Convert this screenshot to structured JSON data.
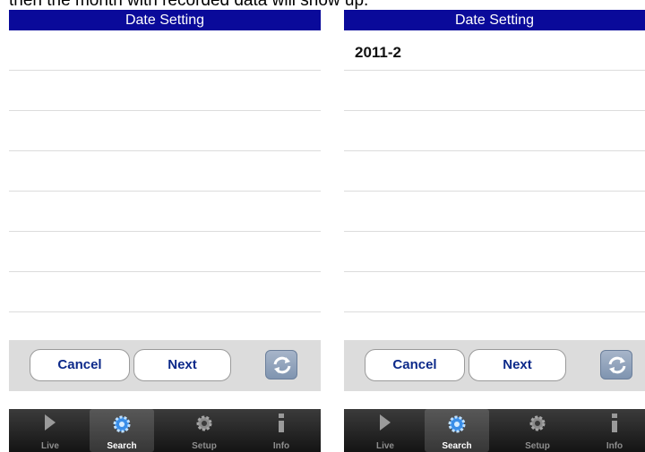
{
  "caption": "then the month with recorded data will show up.",
  "screens": [
    {
      "header_title": "Date Setting",
      "rows": [
        "",
        "",
        "",
        "",
        "",
        "",
        ""
      ],
      "cancel_label": "Cancel",
      "next_label": "Next",
      "tabs": [
        {
          "label": "Live",
          "icon": "play-icon"
        },
        {
          "label": "Search",
          "icon": "gear-icon",
          "active": true
        },
        {
          "label": "Setup",
          "icon": "gear-icon"
        },
        {
          "label": "Info",
          "icon": "info-icon"
        }
      ]
    },
    {
      "header_title": "Date Setting",
      "rows": [
        "2011-2",
        "",
        "",
        "",
        "",
        "",
        ""
      ],
      "cancel_label": "Cancel",
      "next_label": "Next",
      "tabs": [
        {
          "label": "Live",
          "icon": "play-icon"
        },
        {
          "label": "Search",
          "icon": "gear-icon",
          "active": true
        },
        {
          "label": "Setup",
          "icon": "gear-icon"
        },
        {
          "label": "Info",
          "icon": "info-icon"
        }
      ]
    }
  ],
  "colors": {
    "header": "#0a0a9a",
    "button_text": "#0d2a8a",
    "button_bar": "#dcdcdc",
    "tab_bar": "#1e1e1e"
  }
}
